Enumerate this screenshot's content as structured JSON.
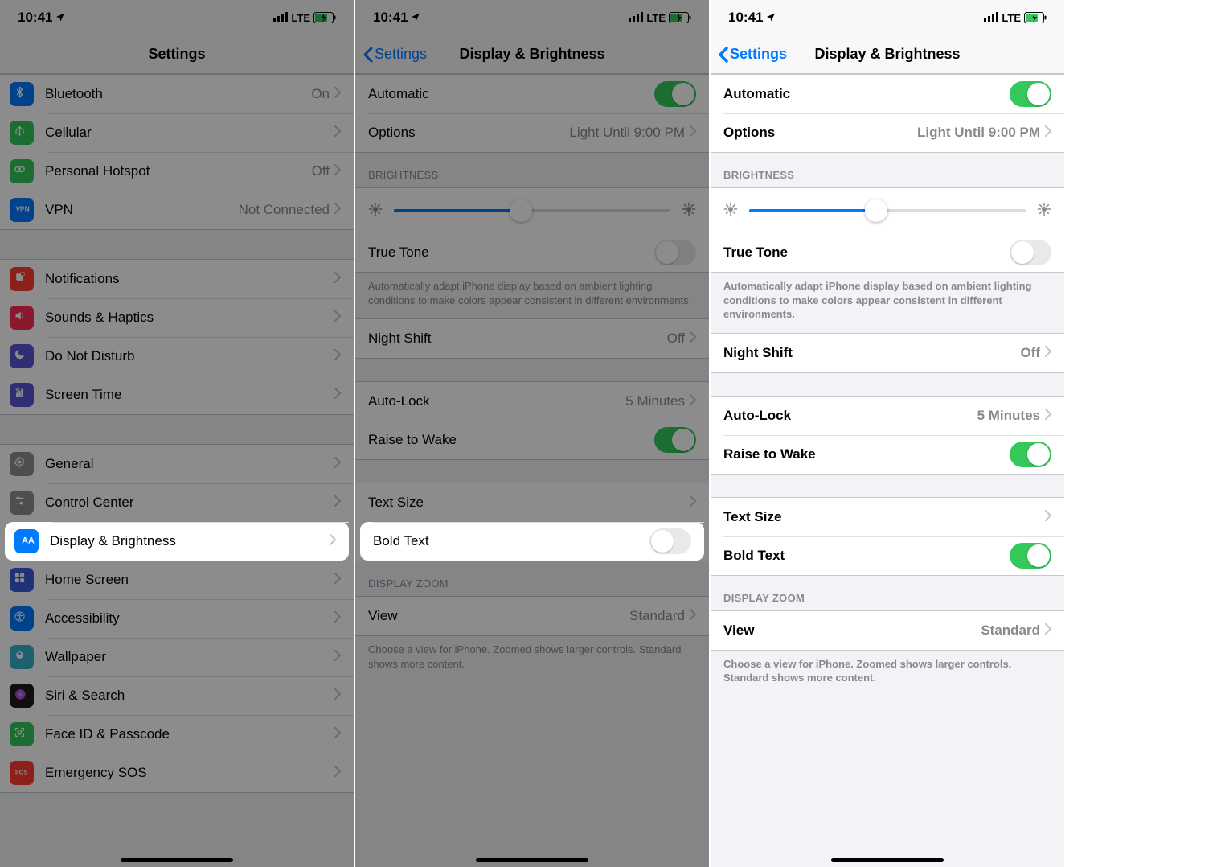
{
  "status": {
    "time": "10:41",
    "network": "LTE"
  },
  "screen1": {
    "title": "Settings",
    "rows_a": [
      {
        "name": "bluetooth",
        "label": "Bluetooth",
        "value": "On",
        "icon_bg": "#007aff"
      },
      {
        "name": "cellular",
        "label": "Cellular",
        "value": "",
        "icon_bg": "#34c759"
      },
      {
        "name": "personal-hotspot",
        "label": "Personal Hotspot",
        "value": "Off",
        "icon_bg": "#34c759"
      },
      {
        "name": "vpn",
        "label": "VPN",
        "value": "Not Connected",
        "icon_bg": "#007aff"
      }
    ],
    "rows_b": [
      {
        "name": "notifications",
        "label": "Notifications",
        "icon_bg": "#ff3b30"
      },
      {
        "name": "sounds-haptics",
        "label": "Sounds & Haptics",
        "icon_bg": "#ff2d55"
      },
      {
        "name": "do-not-disturb",
        "label": "Do Not Disturb",
        "icon_bg": "#5856d6"
      },
      {
        "name": "screen-time",
        "label": "Screen Time",
        "icon_bg": "#5856d6"
      }
    ],
    "rows_c": [
      {
        "name": "general",
        "label": "General",
        "icon_bg": "#8e8e93"
      },
      {
        "name": "control-center",
        "label": "Control Center",
        "icon_bg": "#8e8e93"
      },
      {
        "name": "display-brightness",
        "label": "Display & Brightness",
        "icon_bg": "#007aff",
        "highlight": true
      },
      {
        "name": "home-screen",
        "label": "Home Screen",
        "icon_bg": "#3a5bd9"
      },
      {
        "name": "accessibility",
        "label": "Accessibility",
        "icon_bg": "#007aff"
      },
      {
        "name": "wallpaper",
        "label": "Wallpaper",
        "icon_bg": "#36b1c8"
      },
      {
        "name": "siri-search",
        "label": "Siri & Search",
        "icon_bg": "#1c1c1e"
      },
      {
        "name": "face-id-passcode",
        "label": "Face ID & Passcode",
        "icon_bg": "#34c759"
      },
      {
        "name": "emergency-sos",
        "label": "Emergency SOS",
        "icon_bg": "#ff3b30"
      }
    ]
  },
  "display": {
    "back": "Settings",
    "title": "Display & Brightness",
    "automatic": "Automatic",
    "options": "Options",
    "options_value": "Light Until 9:00 PM",
    "brightness_header": "BRIGHTNESS",
    "true_tone": "True Tone",
    "true_tone_desc": "Automatically adapt iPhone display based on ambient lighting conditions to make colors appear consistent in different environments.",
    "night_shift": "Night Shift",
    "night_shift_value": "Off",
    "auto_lock": "Auto-Lock",
    "auto_lock_value": "5 Minutes",
    "raise_to_wake": "Raise to Wake",
    "text_size": "Text Size",
    "bold_text": "Bold Text",
    "display_zoom_header": "DISPLAY ZOOM",
    "view": "View",
    "view_value": "Standard",
    "zoom_desc": "Choose a view for iPhone. Zoomed shows larger controls. Standard shows more content.",
    "brightness_pct": 46
  },
  "screen2": {
    "bold_text_on": false
  },
  "screen3": {
    "bold_text_on": true
  }
}
